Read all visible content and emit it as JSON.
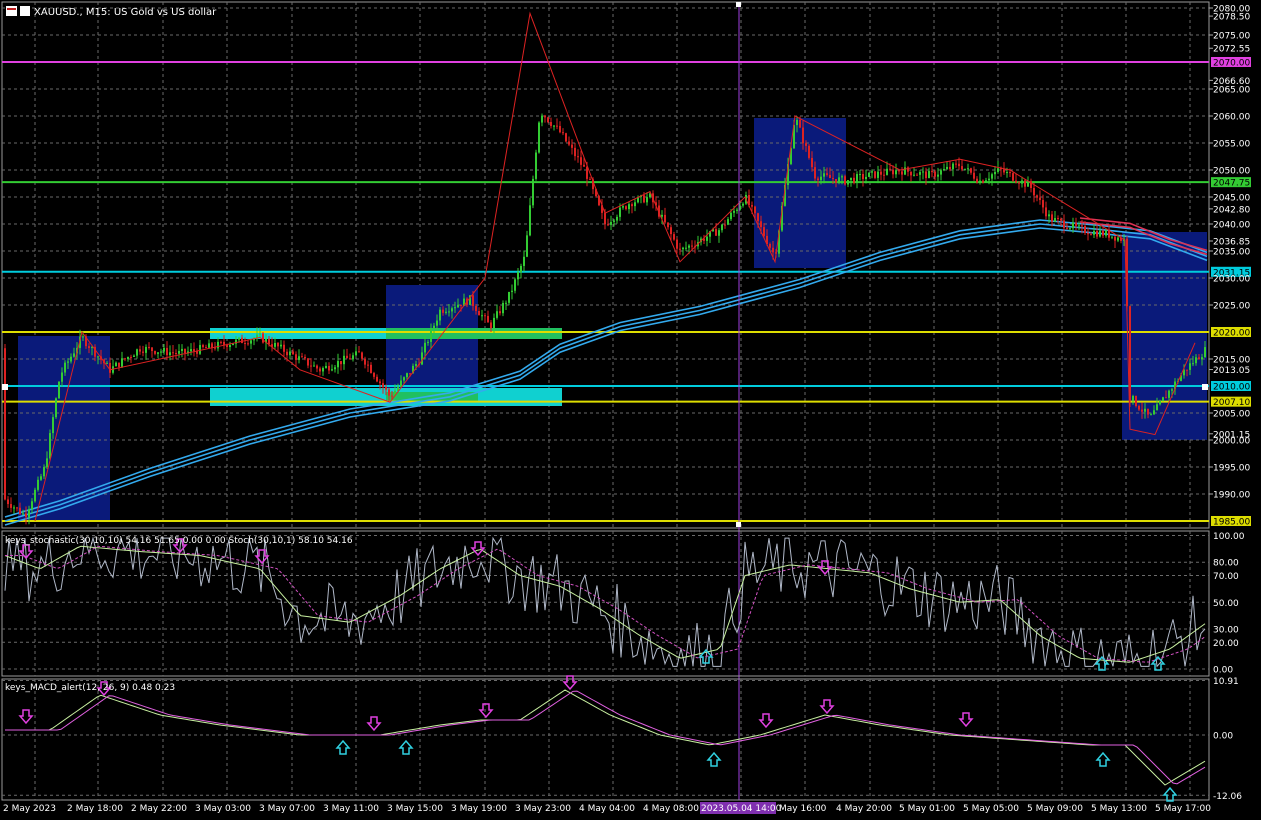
{
  "window": {
    "title": "XAUUSD., M15: US Gold vs US dollar",
    "icon": "chart-window-icon"
  },
  "main_pane": {
    "price_labels": [
      "2080.00",
      "2078.50",
      "2075.00",
      "2072.55",
      "2070.00",
      "2066.60",
      "2065.00",
      "2060.00",
      "2055.00",
      "2050.00",
      "2047.75",
      "2045.00",
      "2042.80",
      "2040.00",
      "2036.85",
      "2035.00",
      "2031.15",
      "2030.00",
      "2025.00",
      "2020.00",
      "2015.00",
      "2013.05",
      "2010.00",
      "2007.10",
      "2005.00",
      "2001.15",
      "2000.00",
      "1995.00",
      "1990.00",
      "1985.00"
    ],
    "highlighted_levels": [
      {
        "price": "2070.00",
        "color": "#e040e0"
      },
      {
        "price": "2047.75",
        "color": "#33cc33"
      },
      {
        "price": "2031.15",
        "color": "#00ccdd"
      },
      {
        "price": "2020.00",
        "color": "#dddd00"
      },
      {
        "price": "2010.00",
        "color": "#00ccdd"
      },
      {
        "price": "2007.10",
        "color": "#dddd00"
      },
      {
        "price": "1985.00",
        "color": "#dddd00"
      }
    ],
    "colors": {
      "bull": "#33cc33",
      "bear": "#dd2222",
      "ma": "#33aaee",
      "ma2": "#dd3355",
      "zone": "#0a1a7a",
      "box": "#10d0d0",
      "grid": "#6a6a6a"
    }
  },
  "stoch_pane": {
    "title": "keys_stochastic(30,10,10) 54.16 51.65 0.00 0.00 Stoch(30,10,1) 58.10 54.16",
    "levels": [
      "100.00",
      "80.00",
      "70.00",
      "50.00",
      "30.00",
      "20.00",
      "0.00"
    ]
  },
  "macd_pane": {
    "title": "keys_MACD_alert(12, 26, 9) 0.48 0.23",
    "levels": [
      "10.91",
      "0.00",
      "-12.06"
    ]
  },
  "time_axis": {
    "labels": [
      "2 May 2023",
      "2 May 18:00",
      "2 May 22:00",
      "3 May 03:00",
      "3 May 07:00",
      "3 May 11:00",
      "3 May 15:00",
      "3 May 19:00",
      "3 May 23:00",
      "4 May 04:00",
      "4 May 08:00",
      "2023.05.04 14:00",
      "May 16:00",
      "4 May 20:00",
      "5 May 01:00",
      "5 May 05:00",
      "5 May 09:00",
      "5 May 13:00",
      "5 May 17:00"
    ],
    "crosshair_label": "2023.05.04 14:00"
  }
}
